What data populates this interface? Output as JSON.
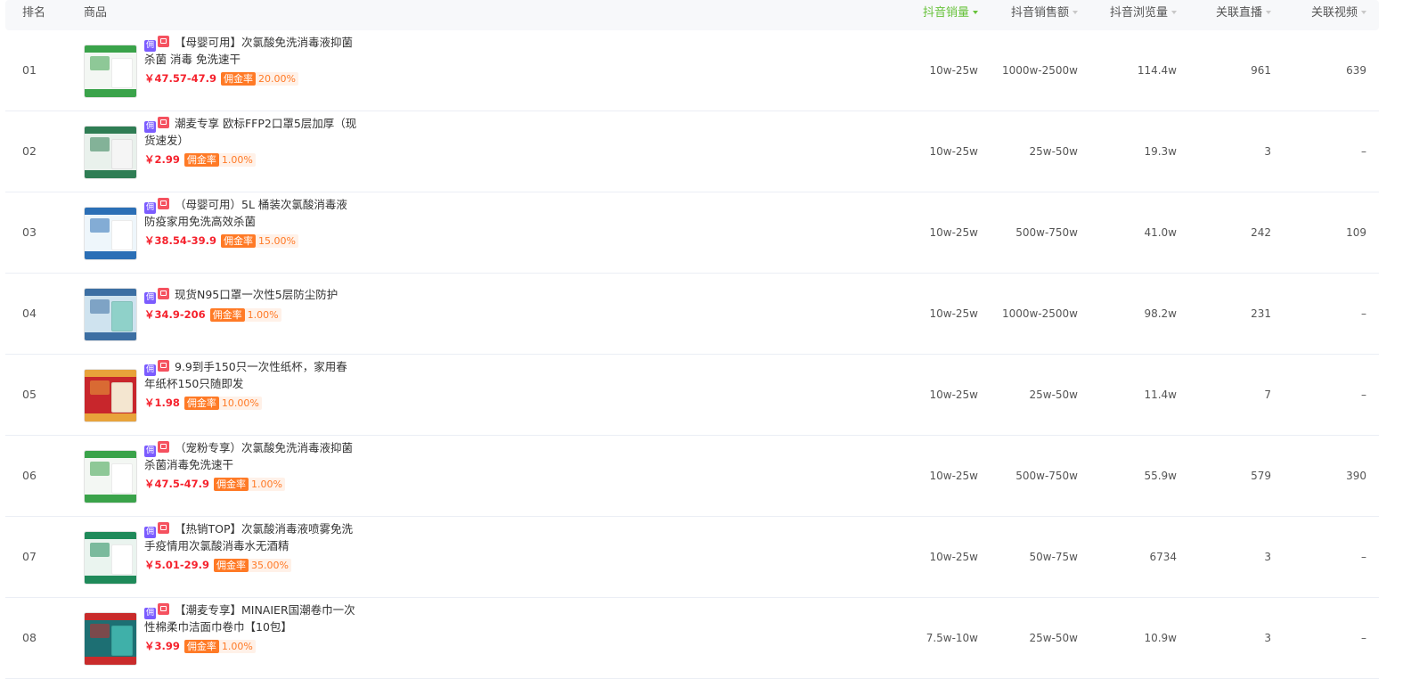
{
  "header": {
    "rank": "排名",
    "goods": "商品",
    "sales": "抖音销量",
    "revenue": "抖音销售额",
    "views": "抖音浏览量",
    "live": "关联直播",
    "video": "关联视频"
  },
  "tags": {
    "yong": "佣",
    "commission_label": "佣金率"
  },
  "colors": {
    "accent": "#67c23a",
    "price": "#f5222d",
    "commission": "#ff7a26",
    "tag_purple": "#7b5cff",
    "tag_red": "#f5515f"
  },
  "rows": [
    {
      "rank": "01",
      "title": "【母婴可用】次氯酸免洗消毒液抑菌 杀菌 消毒 免洗速干",
      "price": "￥47.57-47.9",
      "commission": "20.00%",
      "sales": "10w-25w",
      "revenue": "1000w-2500w",
      "views": "114.4w",
      "live": "961",
      "video": "639"
    },
    {
      "rank": "02",
      "title": "潮麦专享 欧标FFP2口罩5层加厚（现货速发）",
      "price": "￥2.99",
      "commission": "1.00%",
      "sales": "10w-25w",
      "revenue": "25w-50w",
      "views": "19.3w",
      "live": "3",
      "video": "–"
    },
    {
      "rank": "03",
      "title": "（母婴可用）5L 桶装次氯酸消毒液防疫家用免洗高效杀菌",
      "price": "￥38.54-39.9",
      "commission": "15.00%",
      "sales": "10w-25w",
      "revenue": "500w-750w",
      "views": "41.0w",
      "live": "242",
      "video": "109"
    },
    {
      "rank": "04",
      "title": "现货N95口罩一次性5层防尘防护",
      "price": "￥34.9-206",
      "commission": "1.00%",
      "sales": "10w-25w",
      "revenue": "1000w-2500w",
      "views": "98.2w",
      "live": "231",
      "video": "–"
    },
    {
      "rank": "05",
      "title": "9.9到手150只一次性纸杯，家用春年纸杯150只随即发",
      "price": "￥1.98",
      "commission": "10.00%",
      "sales": "10w-25w",
      "revenue": "25w-50w",
      "views": "11.4w",
      "live": "7",
      "video": "–"
    },
    {
      "rank": "06",
      "title": "（宠粉专享）次氯酸免洗消毒液抑菌 杀菌消毒免洗速干",
      "price": "￥47.5-47.9",
      "commission": "1.00%",
      "sales": "10w-25w",
      "revenue": "500w-750w",
      "views": "55.9w",
      "live": "579",
      "video": "390"
    },
    {
      "rank": "07",
      "title": "【热销TOP】次氯酸消毒液喷雾免洗手疫情用次氯酸消毒水无酒精",
      "price": "￥5.01-29.9",
      "commission": "35.00%",
      "sales": "10w-25w",
      "revenue": "50w-75w",
      "views": "6734",
      "live": "3",
      "video": "–"
    },
    {
      "rank": "08",
      "title": "【潮麦专享】MINAIER国潮卷巾一次性棉柔巾洁面巾卷巾【10包】",
      "price": "￥3.99",
      "commission": "1.00%",
      "sales": "7.5w-10w",
      "revenue": "25w-50w",
      "views": "10.9w",
      "live": "3",
      "video": "–"
    }
  ]
}
